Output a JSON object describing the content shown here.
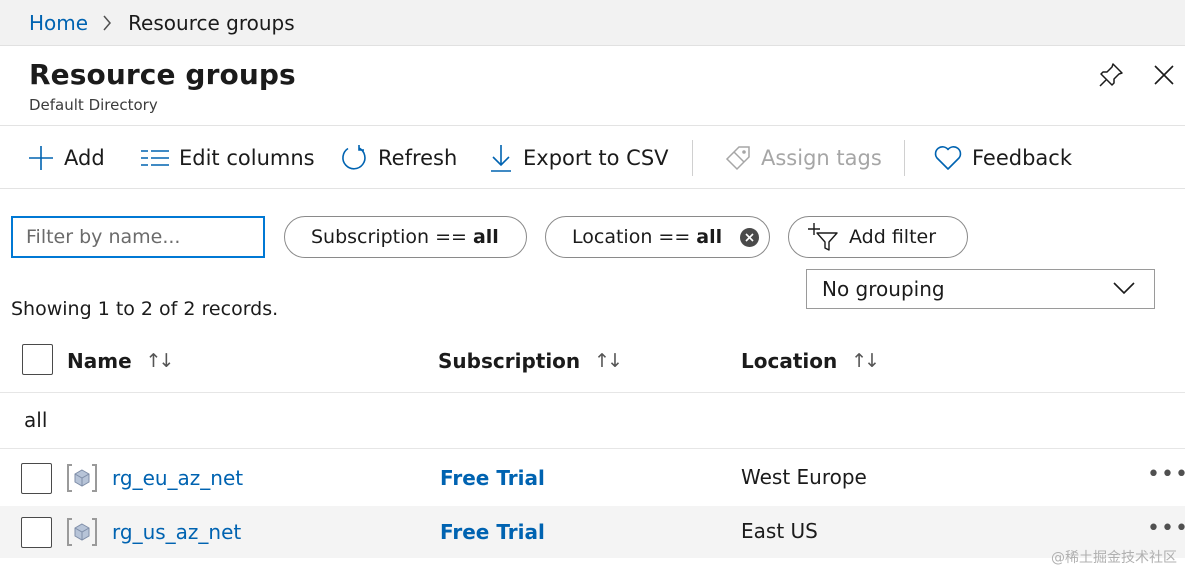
{
  "breadcrumb": {
    "home": "Home",
    "current": "Resource groups"
  },
  "header": {
    "title": "Resource groups",
    "subtitle": "Default Directory"
  },
  "toolbar": {
    "add": "Add",
    "edit_columns": "Edit columns",
    "refresh": "Refresh",
    "export_csv": "Export to CSV",
    "assign_tags": "Assign tags",
    "feedback": "Feedback"
  },
  "filters": {
    "name_placeholder": "Filter by name...",
    "subscription_label": "Subscription ==",
    "subscription_value": "all",
    "location_label": "Location ==",
    "location_value": "all",
    "add_filter": "Add filter",
    "grouping": "No grouping"
  },
  "records_text": "Showing 1 to 2 of 2 records.",
  "table": {
    "columns": [
      "Name",
      "Subscription",
      "Location"
    ],
    "group_label": "all",
    "rows": [
      {
        "name": "rg_eu_az_net",
        "subscription": "Free Trial",
        "location": "West Europe",
        "more": "•••"
      },
      {
        "name": "rg_us_az_net",
        "subscription": "Free Trial",
        "location": "East US",
        "more": "•••"
      }
    ]
  },
  "watermark": "@稀土掘金技术社区",
  "colors": {
    "link": "#0063b1",
    "focus_border": "#0078d4",
    "disabled": "#a6a6a6"
  }
}
